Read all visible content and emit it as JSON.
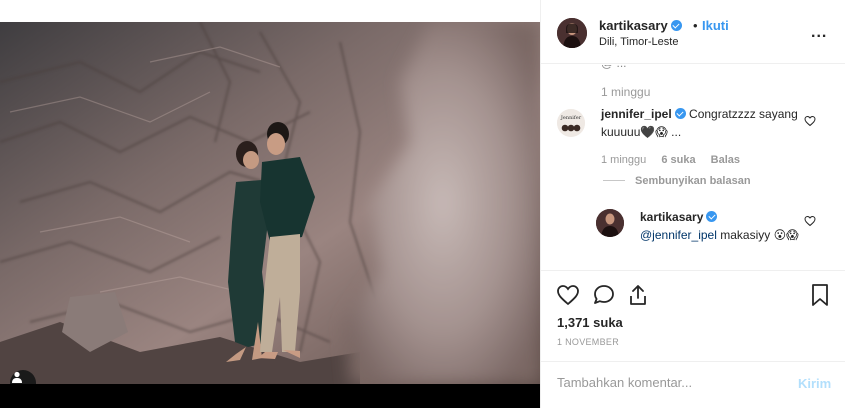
{
  "header": {
    "username": "kartikasary",
    "separator": "•",
    "follow_label": "Ikuti",
    "location": "Dili, Timor-Leste",
    "more_label": "..."
  },
  "comments": {
    "cut_line": "@ ..."
  },
  "caption": {
    "timestamp": "1 minggu"
  },
  "comment1": {
    "username": "jennifer_ipel",
    "text": "Congratzzzz sayang kuuuuu🖤😱 ...",
    "timestamp": "1 minggu",
    "likes": "6 suka",
    "reply_label": "Balas"
  },
  "hide_replies": "Sembunyikan balasan",
  "reply1": {
    "username": "kartikasary",
    "mention": "@jennifer_ipel",
    "text": " makasiyy 😮😱"
  },
  "post": {
    "likes": "1,371 suka",
    "date": "1 NOVEMBER"
  },
  "add_comment": {
    "placeholder": "Tambahkan komentar...",
    "post_label": "Kirim"
  },
  "icons": {
    "verified": "verified-badge-icon",
    "like": "heart-icon",
    "comment": "comment-icon",
    "share": "share-icon",
    "save": "bookmark-icon",
    "user_tag": "user-tag-icon"
  },
  "colors": {
    "accent": "#3897f0",
    "post_disabled": "#b2dffc",
    "muted": "#999999"
  }
}
